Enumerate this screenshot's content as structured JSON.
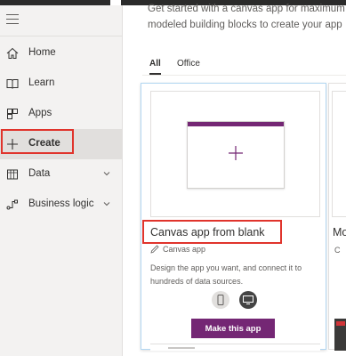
{
  "nav": {
    "items": [
      {
        "label": "Home",
        "icon": "home-icon"
      },
      {
        "label": "Learn",
        "icon": "book-icon"
      },
      {
        "label": "Apps",
        "icon": "apps-icon"
      },
      {
        "label": "Create",
        "icon": "plus-icon",
        "selected": true
      },
      {
        "label": "Data",
        "icon": "table-icon",
        "has_chevron": true
      },
      {
        "label": "Business logic",
        "icon": "flow-icon",
        "has_chevron": true
      }
    ]
  },
  "main": {
    "intro_line1": "Get started with a canvas app for maximum",
    "intro_line2": "modeled building blocks to create your app",
    "tabs": [
      {
        "label": "All",
        "active": true
      },
      {
        "label": "Office",
        "active": false
      }
    ],
    "card": {
      "title": "Canvas app from blank",
      "subtitle": "Canvas app",
      "description": "Design the app you want, and connect it to hundreds of data sources.",
      "button_label": "Make this app"
    },
    "card2": {
      "title_fragment": "Mo",
      "subtitle_fragment": "C"
    }
  },
  "colors": {
    "accent": "#742774",
    "highlight": "#e0342c",
    "nav_bg": "#f3f2f1"
  }
}
